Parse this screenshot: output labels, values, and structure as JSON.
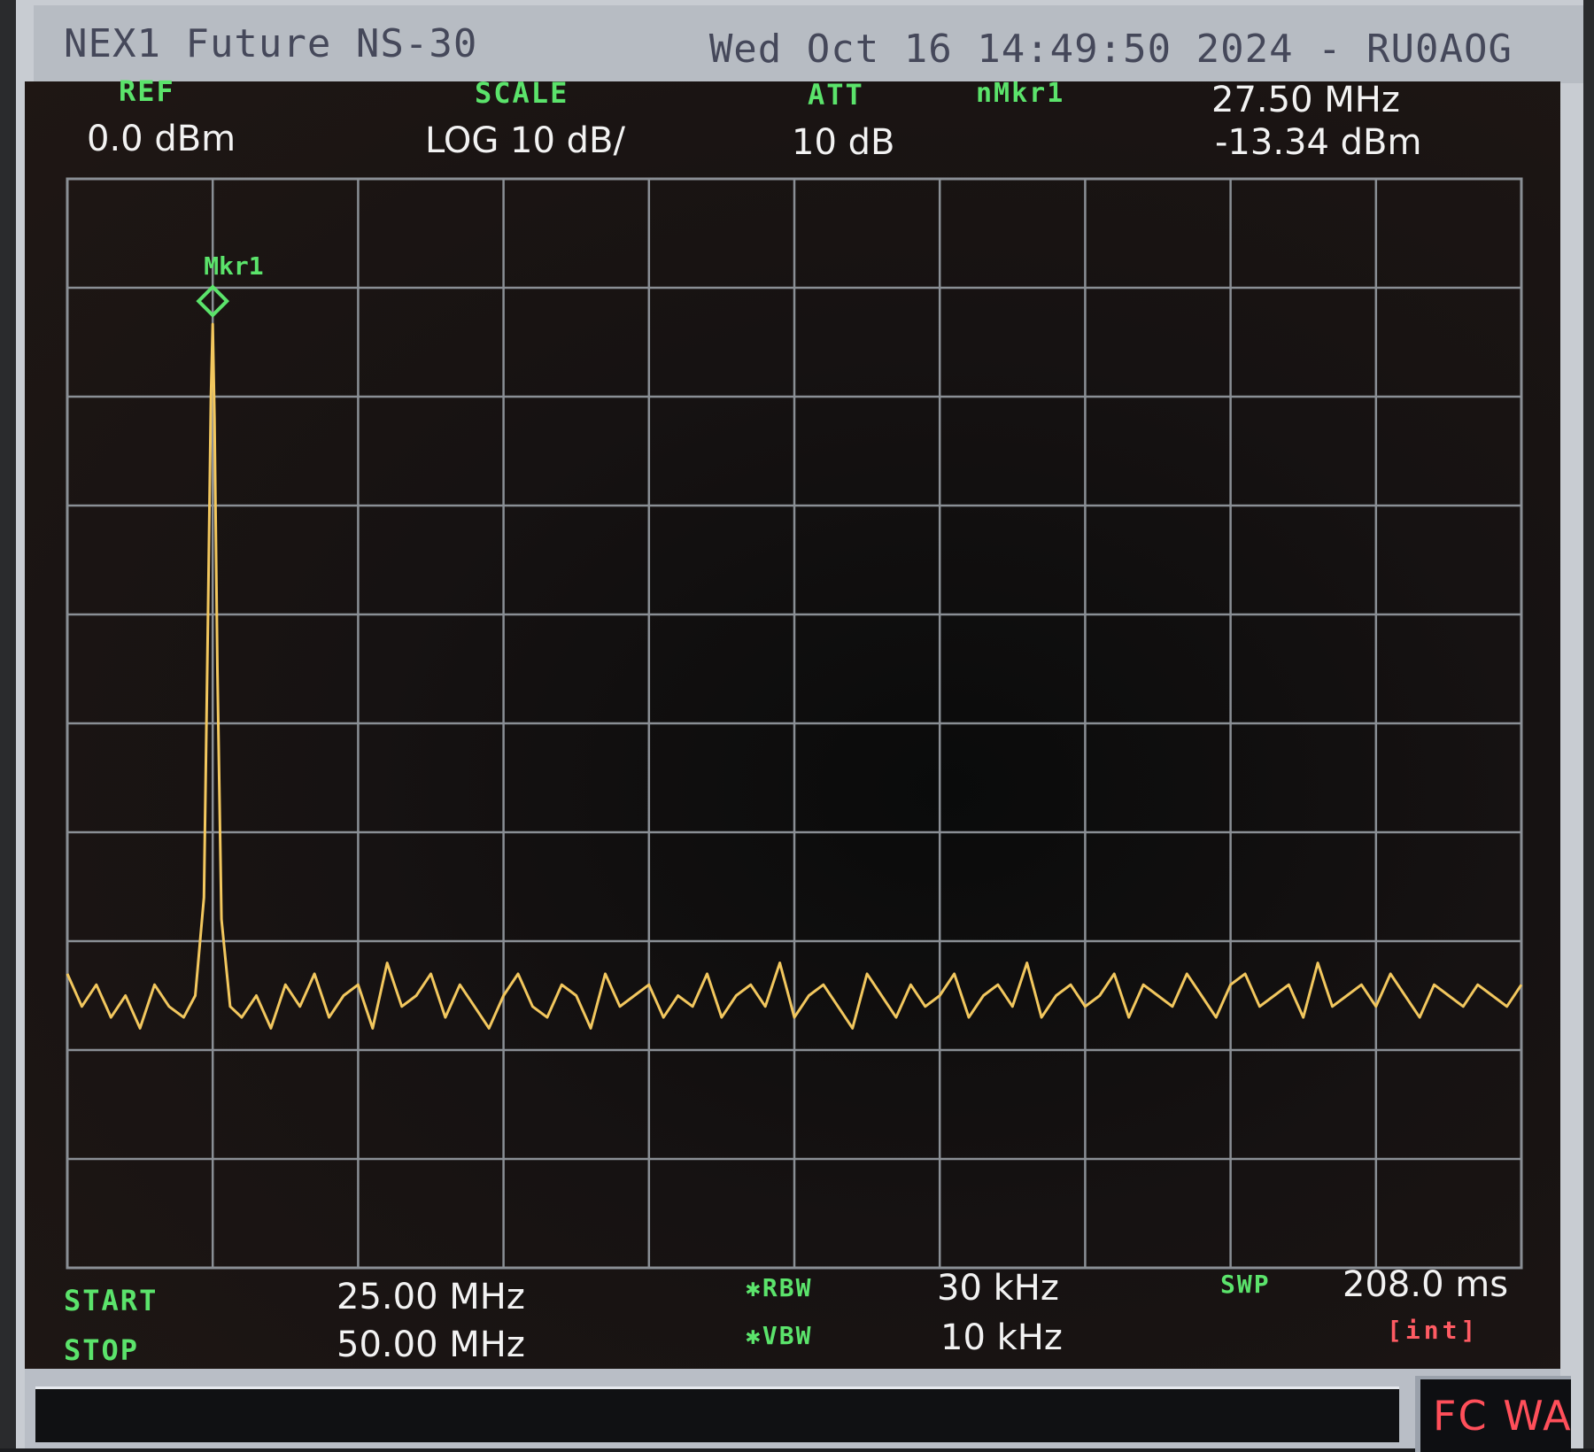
{
  "header": {
    "instrument": "NEX1 Future NS-30",
    "timestamp": "Wed Oct 16 14:49:50 2024 - RU0AOG"
  },
  "readouts": {
    "ref_label": "REF",
    "ref_value": "0.0 dBm",
    "scale_label": "SCALE",
    "scale_value": "LOG 10 dB/",
    "att_label": "ATT",
    "att_value": "10 dB",
    "marker_label": "nMkr1",
    "marker_freq": "27.50 MHz",
    "marker_level": "-13.34 dBm",
    "start_label": "START",
    "start_value": "25.00 MHz",
    "stop_label": "STOP",
    "stop_value": "50.00 MHz",
    "rbw_label": "✱RBW",
    "rbw_value": "30 kHz",
    "vbw_label": "✱VBW",
    "vbw_value": "10 kHz",
    "swp_label": "SWP",
    "swp_value": "208.0 ms",
    "swp_mode": "[int]"
  },
  "status": {
    "fc_text": "FC WAB"
  },
  "colors": {
    "trace": "#f2c75e",
    "grid": "#8a8f95",
    "label_green": "#5be36b",
    "marker": "#5be36b",
    "warn_red": "#ff5b63"
  },
  "chart_data": {
    "type": "line",
    "x_unit": "MHz",
    "y_unit": "dBm",
    "xlim": [
      25.0,
      50.0
    ],
    "ylim": [
      -100,
      0
    ],
    "x_divisions": 10,
    "y_divisions": 10,
    "grid": true,
    "series": [
      {
        "name": "",
        "x": [
          25.0,
          25.25,
          25.5,
          25.75,
          26.0,
          26.25,
          26.5,
          26.75,
          27.0,
          27.2,
          27.35,
          27.42,
          27.47,
          27.5,
          27.53,
          27.58,
          27.65,
          27.8,
          28.0,
          28.25,
          28.5,
          28.75,
          29.0,
          29.25,
          29.5,
          29.75,
          30.0,
          30.25,
          30.5,
          30.75,
          31.0,
          31.25,
          31.5,
          31.75,
          32.0,
          32.25,
          32.5,
          32.75,
          33.0,
          33.25,
          33.5,
          33.75,
          34.0,
          34.25,
          34.5,
          34.75,
          35.0,
          35.25,
          35.5,
          35.75,
          36.0,
          36.25,
          36.5,
          36.75,
          37.0,
          37.25,
          37.5,
          37.75,
          38.0,
          38.25,
          38.5,
          38.75,
          39.0,
          39.25,
          39.5,
          39.75,
          40.0,
          40.25,
          40.5,
          40.75,
          41.0,
          41.25,
          41.5,
          41.75,
          42.0,
          42.25,
          42.5,
          42.75,
          43.0,
          43.25,
          43.5,
          43.75,
          44.0,
          44.25,
          44.5,
          44.75,
          45.0,
          45.25,
          45.5,
          45.75,
          46.0,
          46.25,
          46.5,
          46.75,
          47.0,
          47.25,
          47.5,
          47.75,
          48.0,
          48.25,
          48.5,
          48.75,
          49.0,
          49.25,
          49.5,
          49.75,
          50.0
        ],
        "y": [
          -73,
          -76,
          -74,
          -77,
          -75,
          -78,
          -74,
          -76,
          -77,
          -75,
          -66,
          -40,
          -20,
          -13.34,
          -22,
          -45,
          -68,
          -76,
          -77,
          -75,
          -78,
          -74,
          -76,
          -73,
          -77,
          -75,
          -74,
          -78,
          -72,
          -76,
          -75,
          -73,
          -77,
          -74,
          -76,
          -78,
          -75,
          -73,
          -76,
          -77,
          -74,
          -75,
          -78,
          -73,
          -76,
          -75,
          -74,
          -77,
          -75,
          -76,
          -73,
          -77,
          -75,
          -74,
          -76,
          -72,
          -77,
          -75,
          -74,
          -76,
          -78,
          -73,
          -75,
          -77,
          -74,
          -76,
          -75,
          -73,
          -77,
          -75,
          -74,
          -76,
          -72,
          -77,
          -75,
          -74,
          -76,
          -75,
          -73,
          -77,
          -74,
          -75,
          -76,
          -73,
          -75,
          -77,
          -74,
          -73,
          -76,
          -75,
          -74,
          -77,
          -72,
          -76,
          -75,
          -74,
          -76,
          -73,
          -75,
          -77,
          -74,
          -75,
          -76,
          -74,
          -75,
          -76,
          -74
        ]
      }
    ],
    "markers": [
      {
        "label": "Mkr1",
        "x": 27.5,
        "y": -13.34
      }
    ]
  }
}
